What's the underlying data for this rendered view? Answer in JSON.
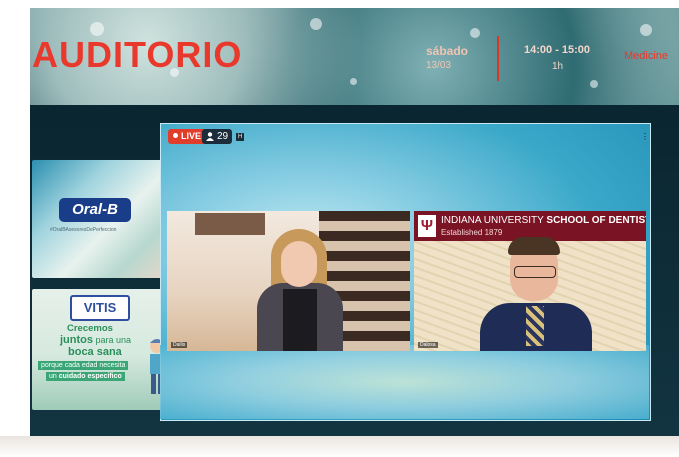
{
  "banner": {
    "title": "AUDITORIO",
    "day": "sábado",
    "date": "13/03",
    "time_range": "14:00 - 15:00",
    "duration": "1h",
    "cut_label": "Medicine"
  },
  "stream": {
    "live_label": "LIVE",
    "viewer_count": "29",
    "viewers_extra": "H",
    "menu_icon": "more-dots-icon"
  },
  "tiles": {
    "left_name": "Dailis",
    "right_name": "Dalosa",
    "right_header": {
      "university": "INDIANA UNIVERSITY",
      "school": "SCHOOL OF DENTISTRY",
      "established": "Established 1879",
      "logo_glyph": "Ψ"
    }
  },
  "sidebar": {
    "oralb": {
      "logo": "Oral-B",
      "tag": "#OralBAsesoresDePerfeccion"
    },
    "vitis": {
      "logo": "VITIS",
      "line1": "Crecemos",
      "line2a": "juntos",
      "line2b": "para una",
      "line3": "boca sana",
      "line4": "porque cada edad necesita",
      "line5a": "un",
      "line5b": "cuidado específico"
    }
  },
  "colors": {
    "accent": "#e8392c",
    "live": "#e23d2b",
    "iu_red": "#7a1324"
  }
}
